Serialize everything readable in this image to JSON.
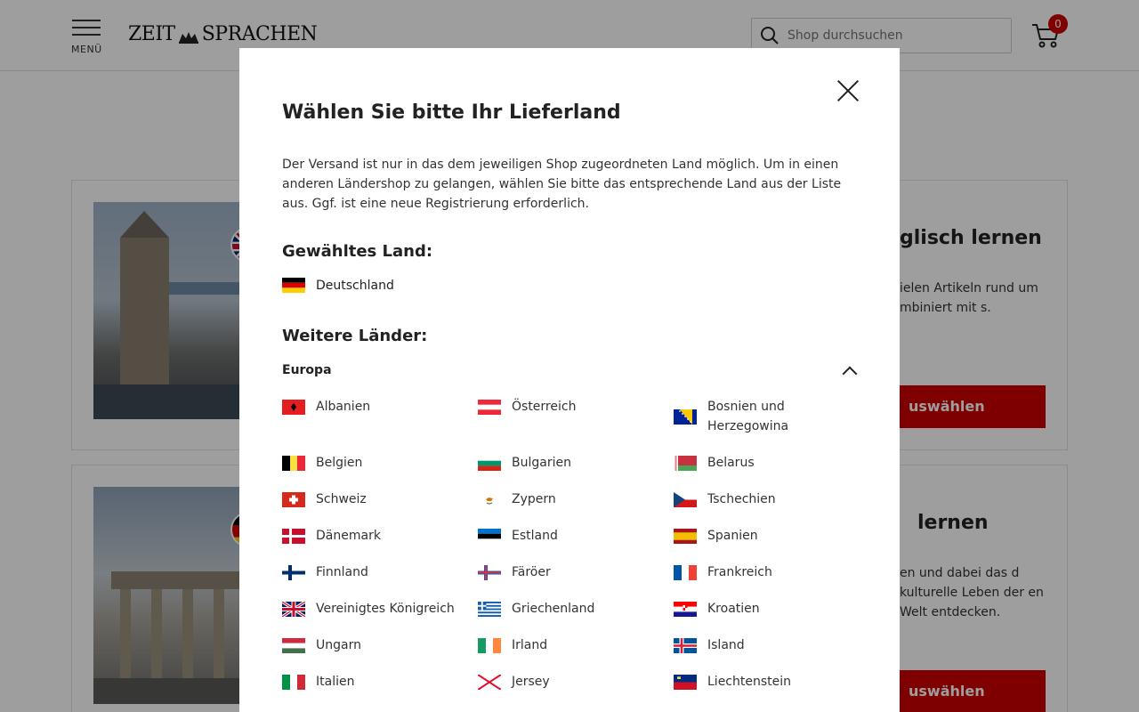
{
  "header": {
    "menu_label": "MENÜ",
    "logo_left": "ZEIT",
    "logo_right": "SPRACHEN",
    "search_placeholder": "Shop durchsuchen",
    "cart_count": "0"
  },
  "cards": [
    {
      "title": "glisch lernen",
      "text": "ielen Artikeln rund um mbiniert mit s.",
      "cta": "uswählen"
    },
    {
      "title": "lernen",
      "text": "en und dabei das d kulturelle Leben der en Welt entdecken.",
      "cta": "uswählen"
    }
  ],
  "modal": {
    "title": "Wählen Sie bitte Ihr Lieferland",
    "intro": "Der Versand ist nur in das dem jeweiligen Shop zugeordneten Land möglich. Um in einen anderen Ländershop zu gelangen, wählen Sie bitte das entsprechende Land aus der Liste aus. Ggf. ist eine neue Registrierung erforderlich.",
    "selected_heading": "Gewähltes Land:",
    "selected_country": "Deutschland",
    "more_heading": "Weitere Länder:",
    "region": "Europa",
    "countries": [
      {
        "name": "Albanien",
        "flag": "al"
      },
      {
        "name": "Österreich",
        "flag": "at"
      },
      {
        "name": "Bosnien und Herzegowina",
        "flag": "ba"
      },
      {
        "name": "Belgien",
        "flag": "be"
      },
      {
        "name": "Bulgarien",
        "flag": "bg"
      },
      {
        "name": "Belarus",
        "flag": "by"
      },
      {
        "name": "Schweiz",
        "flag": "ch"
      },
      {
        "name": "Zypern",
        "flag": "cy"
      },
      {
        "name": "Tschechien",
        "flag": "cz"
      },
      {
        "name": "Dänemark",
        "flag": "dk"
      },
      {
        "name": "Estland",
        "flag": "ee"
      },
      {
        "name": "Spanien",
        "flag": "es"
      },
      {
        "name": "Finnland",
        "flag": "fi"
      },
      {
        "name": "Färöer",
        "flag": "fo"
      },
      {
        "name": "Frankreich",
        "flag": "fr"
      },
      {
        "name": "Vereinigtes Königreich",
        "flag": "gb"
      },
      {
        "name": "Griechenland",
        "flag": "gr"
      },
      {
        "name": "Kroatien",
        "flag": "hr"
      },
      {
        "name": "Ungarn",
        "flag": "hu"
      },
      {
        "name": "Irland",
        "flag": "ie"
      },
      {
        "name": "Island",
        "flag": "is"
      },
      {
        "name": "Italien",
        "flag": "it"
      },
      {
        "name": "Jersey",
        "flag": "je"
      },
      {
        "name": "Liechtenstein",
        "flag": "li"
      }
    ]
  },
  "colors": {
    "accent": "#cc0000",
    "overlay": "rgba(0,0,0,0.38)"
  }
}
